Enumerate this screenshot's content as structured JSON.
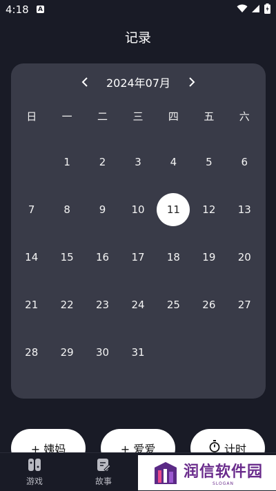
{
  "status": {
    "time": "4:18",
    "badge": "A"
  },
  "title": "记录",
  "calendar": {
    "month_label": "2024年07月",
    "weekdays": [
      "日",
      "一",
      "二",
      "三",
      "四",
      "五",
      "六"
    ],
    "days": [
      "",
      "1",
      "2",
      "3",
      "4",
      "5",
      "6",
      "7",
      "8",
      "9",
      "10",
      "11",
      "12",
      "13",
      "14",
      "15",
      "16",
      "17",
      "18",
      "19",
      "20",
      "21",
      "22",
      "23",
      "24",
      "25",
      "26",
      "27",
      "28",
      "29",
      "30",
      "31",
      "",
      "",
      ""
    ],
    "selected_day": "11"
  },
  "actions": {
    "period_label": "+ 姨妈",
    "love_label": "+ 爱爱",
    "timer_label": "计时"
  },
  "nav": {
    "games_label": "游戏",
    "stories_label": "故事"
  },
  "watermark": {
    "title": "润信软件园",
    "slogan": "SLOGAN"
  }
}
